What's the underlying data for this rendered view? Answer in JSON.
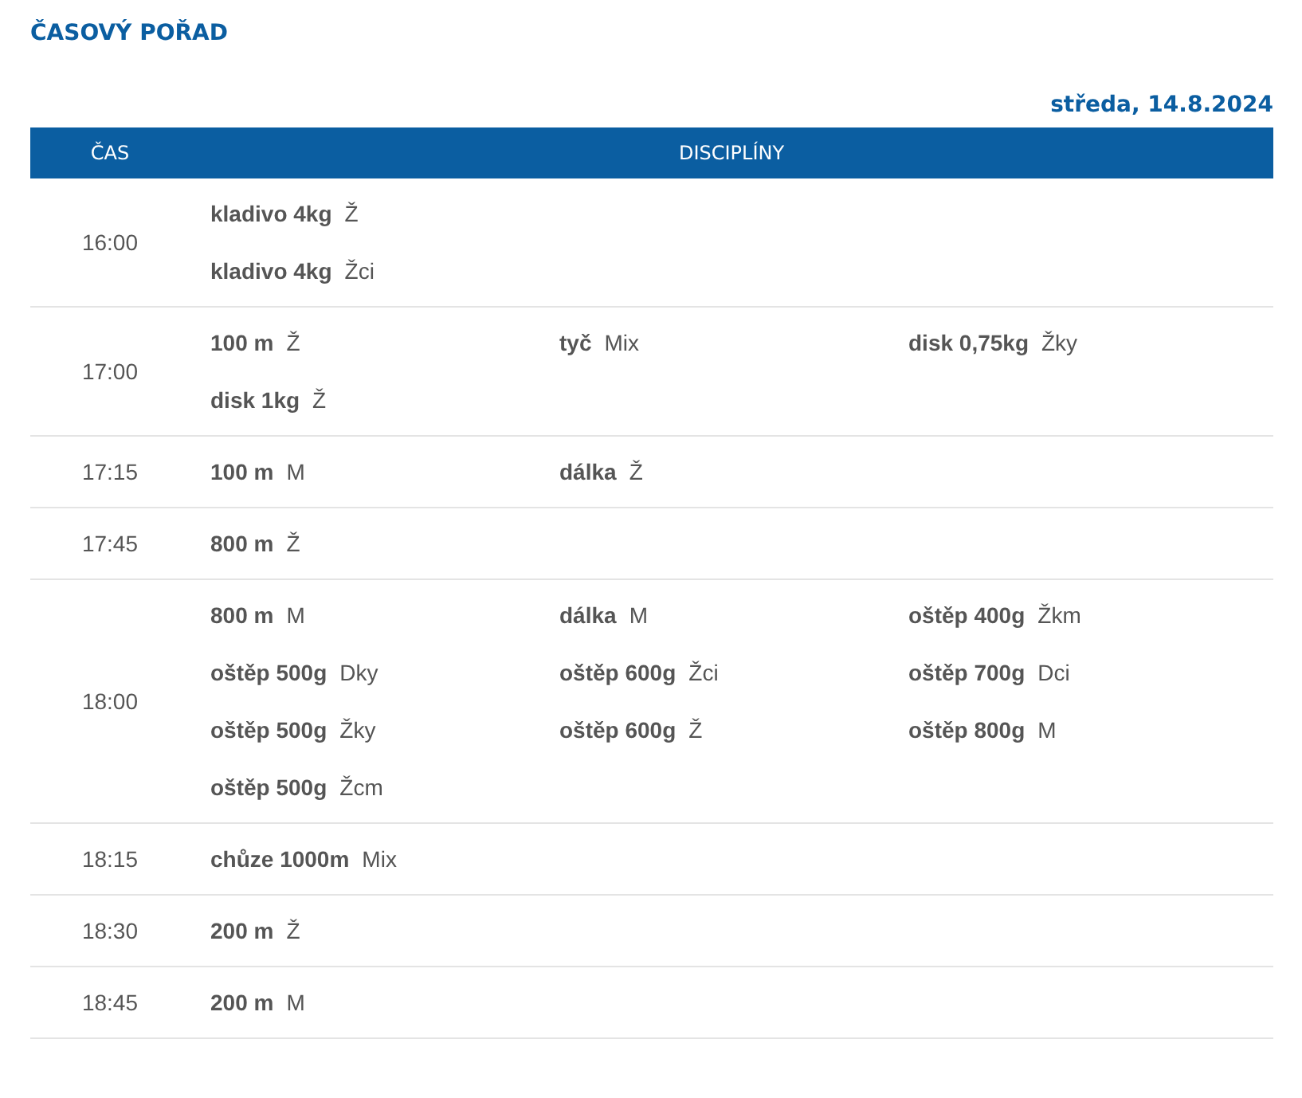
{
  "title": "ČASOVÝ POŘAD",
  "date": "středa, 14.8.2024",
  "table": {
    "columns": [
      "ČAS",
      "DISCIPLÍNY"
    ],
    "rows": [
      {
        "time": "16:00",
        "events": [
          {
            "name": "kladivo 4kg",
            "category": "Ž"
          },
          {
            "name": "kladivo 4kg",
            "category": "Žci"
          }
        ],
        "kind": "single"
      },
      {
        "time": "17:00",
        "events": [
          {
            "name": "100 m",
            "category": "Ž"
          },
          {
            "name": "tyč",
            "category": "Mix"
          },
          {
            "name": "disk 0,75kg",
            "category": "Žky"
          },
          {
            "name": "disk 1kg",
            "category": "Ž"
          }
        ],
        "kind": "grid"
      },
      {
        "time": "17:15",
        "events": [
          {
            "name": "100 m",
            "category": "M"
          },
          {
            "name": "dálka",
            "category": "Ž"
          }
        ],
        "kind": "grid"
      },
      {
        "time": "17:45",
        "events": [
          {
            "name": "800 m",
            "category": "Ž"
          }
        ],
        "kind": "grid"
      },
      {
        "time": "18:00",
        "events": [
          {
            "name": "800 m",
            "category": "M"
          },
          {
            "name": "dálka",
            "category": "M"
          },
          {
            "name": "oštěp 400g",
            "category": "Žkm"
          },
          {
            "name": "oštěp 500g",
            "category": "Dky"
          },
          {
            "name": "oštěp 600g",
            "category": "Žci"
          },
          {
            "name": "oštěp 700g",
            "category": "Dci"
          },
          {
            "name": "oštěp 500g",
            "category": "Žky"
          },
          {
            "name": "oštěp 600g",
            "category": "Ž"
          },
          {
            "name": "oštěp 800g",
            "category": "M"
          },
          {
            "name": "oštěp 500g",
            "category": "Žcm"
          }
        ],
        "kind": "grid"
      },
      {
        "time": "18:15",
        "events": [
          {
            "name": "chůze 1000m",
            "category": "Mix"
          }
        ],
        "kind": "grid"
      },
      {
        "time": "18:30",
        "events": [
          {
            "name": "200 m",
            "category": "Ž"
          }
        ],
        "kind": "grid"
      },
      {
        "time": "18:45",
        "events": [
          {
            "name": "200 m",
            "category": "M"
          }
        ],
        "kind": "grid"
      }
    ]
  }
}
